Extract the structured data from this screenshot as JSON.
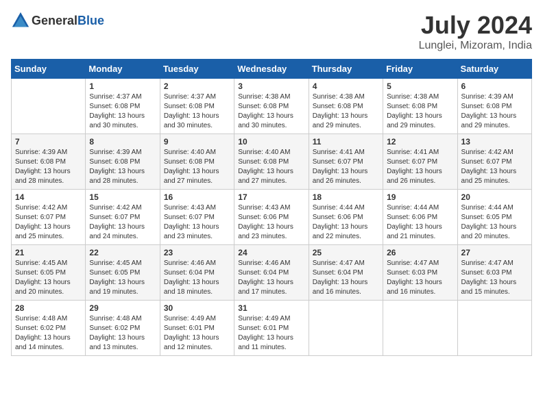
{
  "header": {
    "logo_general": "General",
    "logo_blue": "Blue",
    "month": "July 2024",
    "location": "Lunglei, Mizoram, India"
  },
  "weekdays": [
    "Sunday",
    "Monday",
    "Tuesday",
    "Wednesday",
    "Thursday",
    "Friday",
    "Saturday"
  ],
  "weeks": [
    [
      {
        "day": "",
        "sunrise": "",
        "sunset": "",
        "daylight": ""
      },
      {
        "day": "1",
        "sunrise": "Sunrise: 4:37 AM",
        "sunset": "Sunset: 6:08 PM",
        "daylight": "Daylight: 13 hours and 30 minutes."
      },
      {
        "day": "2",
        "sunrise": "Sunrise: 4:37 AM",
        "sunset": "Sunset: 6:08 PM",
        "daylight": "Daylight: 13 hours and 30 minutes."
      },
      {
        "day": "3",
        "sunrise": "Sunrise: 4:38 AM",
        "sunset": "Sunset: 6:08 PM",
        "daylight": "Daylight: 13 hours and 30 minutes."
      },
      {
        "day": "4",
        "sunrise": "Sunrise: 4:38 AM",
        "sunset": "Sunset: 6:08 PM",
        "daylight": "Daylight: 13 hours and 29 minutes."
      },
      {
        "day": "5",
        "sunrise": "Sunrise: 4:38 AM",
        "sunset": "Sunset: 6:08 PM",
        "daylight": "Daylight: 13 hours and 29 minutes."
      },
      {
        "day": "6",
        "sunrise": "Sunrise: 4:39 AM",
        "sunset": "Sunset: 6:08 PM",
        "daylight": "Daylight: 13 hours and 29 minutes."
      }
    ],
    [
      {
        "day": "7",
        "sunrise": "Sunrise: 4:39 AM",
        "sunset": "Sunset: 6:08 PM",
        "daylight": "Daylight: 13 hours and 28 minutes."
      },
      {
        "day": "8",
        "sunrise": "Sunrise: 4:39 AM",
        "sunset": "Sunset: 6:08 PM",
        "daylight": "Daylight: 13 hours and 28 minutes."
      },
      {
        "day": "9",
        "sunrise": "Sunrise: 4:40 AM",
        "sunset": "Sunset: 6:08 PM",
        "daylight": "Daylight: 13 hours and 27 minutes."
      },
      {
        "day": "10",
        "sunrise": "Sunrise: 4:40 AM",
        "sunset": "Sunset: 6:08 PM",
        "daylight": "Daylight: 13 hours and 27 minutes."
      },
      {
        "day": "11",
        "sunrise": "Sunrise: 4:41 AM",
        "sunset": "Sunset: 6:07 PM",
        "daylight": "Daylight: 13 hours and 26 minutes."
      },
      {
        "day": "12",
        "sunrise": "Sunrise: 4:41 AM",
        "sunset": "Sunset: 6:07 PM",
        "daylight": "Daylight: 13 hours and 26 minutes."
      },
      {
        "day": "13",
        "sunrise": "Sunrise: 4:42 AM",
        "sunset": "Sunset: 6:07 PM",
        "daylight": "Daylight: 13 hours and 25 minutes."
      }
    ],
    [
      {
        "day": "14",
        "sunrise": "Sunrise: 4:42 AM",
        "sunset": "Sunset: 6:07 PM",
        "daylight": "Daylight: 13 hours and 25 minutes."
      },
      {
        "day": "15",
        "sunrise": "Sunrise: 4:42 AM",
        "sunset": "Sunset: 6:07 PM",
        "daylight": "Daylight: 13 hours and 24 minutes."
      },
      {
        "day": "16",
        "sunrise": "Sunrise: 4:43 AM",
        "sunset": "Sunset: 6:07 PM",
        "daylight": "Daylight: 13 hours and 23 minutes."
      },
      {
        "day": "17",
        "sunrise": "Sunrise: 4:43 AM",
        "sunset": "Sunset: 6:06 PM",
        "daylight": "Daylight: 13 hours and 23 minutes."
      },
      {
        "day": "18",
        "sunrise": "Sunrise: 4:44 AM",
        "sunset": "Sunset: 6:06 PM",
        "daylight": "Daylight: 13 hours and 22 minutes."
      },
      {
        "day": "19",
        "sunrise": "Sunrise: 4:44 AM",
        "sunset": "Sunset: 6:06 PM",
        "daylight": "Daylight: 13 hours and 21 minutes."
      },
      {
        "day": "20",
        "sunrise": "Sunrise: 4:44 AM",
        "sunset": "Sunset: 6:05 PM",
        "daylight": "Daylight: 13 hours and 20 minutes."
      }
    ],
    [
      {
        "day": "21",
        "sunrise": "Sunrise: 4:45 AM",
        "sunset": "Sunset: 6:05 PM",
        "daylight": "Daylight: 13 hours and 20 minutes."
      },
      {
        "day": "22",
        "sunrise": "Sunrise: 4:45 AM",
        "sunset": "Sunset: 6:05 PM",
        "daylight": "Daylight: 13 hours and 19 minutes."
      },
      {
        "day": "23",
        "sunrise": "Sunrise: 4:46 AM",
        "sunset": "Sunset: 6:04 PM",
        "daylight": "Daylight: 13 hours and 18 minutes."
      },
      {
        "day": "24",
        "sunrise": "Sunrise: 4:46 AM",
        "sunset": "Sunset: 6:04 PM",
        "daylight": "Daylight: 13 hours and 17 minutes."
      },
      {
        "day": "25",
        "sunrise": "Sunrise: 4:47 AM",
        "sunset": "Sunset: 6:04 PM",
        "daylight": "Daylight: 13 hours and 16 minutes."
      },
      {
        "day": "26",
        "sunrise": "Sunrise: 4:47 AM",
        "sunset": "Sunset: 6:03 PM",
        "daylight": "Daylight: 13 hours and 16 minutes."
      },
      {
        "day": "27",
        "sunrise": "Sunrise: 4:47 AM",
        "sunset": "Sunset: 6:03 PM",
        "daylight": "Daylight: 13 hours and 15 minutes."
      }
    ],
    [
      {
        "day": "28",
        "sunrise": "Sunrise: 4:48 AM",
        "sunset": "Sunset: 6:02 PM",
        "daylight": "Daylight: 13 hours and 14 minutes."
      },
      {
        "day": "29",
        "sunrise": "Sunrise: 4:48 AM",
        "sunset": "Sunset: 6:02 PM",
        "daylight": "Daylight: 13 hours and 13 minutes."
      },
      {
        "day": "30",
        "sunrise": "Sunrise: 4:49 AM",
        "sunset": "Sunset: 6:01 PM",
        "daylight": "Daylight: 13 hours and 12 minutes."
      },
      {
        "day": "31",
        "sunrise": "Sunrise: 4:49 AM",
        "sunset": "Sunset: 6:01 PM",
        "daylight": "Daylight: 13 hours and 11 minutes."
      },
      {
        "day": "",
        "sunrise": "",
        "sunset": "",
        "daylight": ""
      },
      {
        "day": "",
        "sunrise": "",
        "sunset": "",
        "daylight": ""
      },
      {
        "day": "",
        "sunrise": "",
        "sunset": "",
        "daylight": ""
      }
    ]
  ]
}
